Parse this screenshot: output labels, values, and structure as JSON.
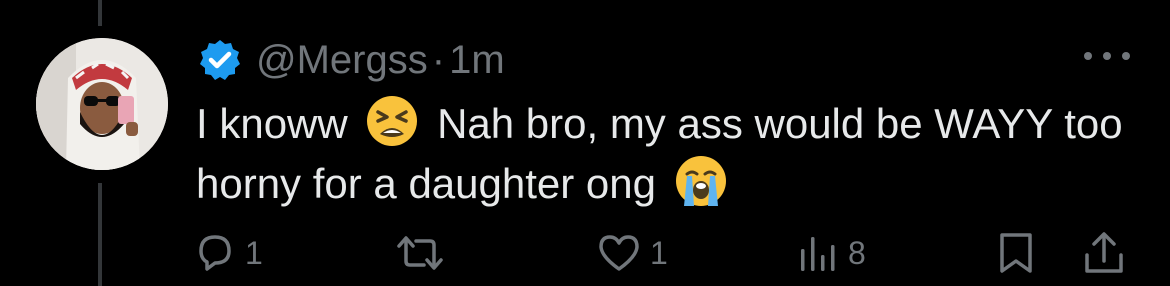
{
  "tweet": {
    "handle": "@Mergss",
    "separator": "·",
    "time": "1m",
    "verified": true,
    "text_part1": "I knoww",
    "text_part2": "Nah bro, my ass would be WAYY too horny for a daughter ong",
    "emoji1": "tired-face-emoji",
    "emoji2": "loudly-crying-face-emoji"
  },
  "actions": {
    "reply_count": "1",
    "retweet_count": "",
    "like_count": "1",
    "views_count": "8"
  },
  "colors": {
    "background": "#000000",
    "text": "#e7e9ea",
    "muted": "#71767b",
    "verified": "#1d9bf0"
  }
}
